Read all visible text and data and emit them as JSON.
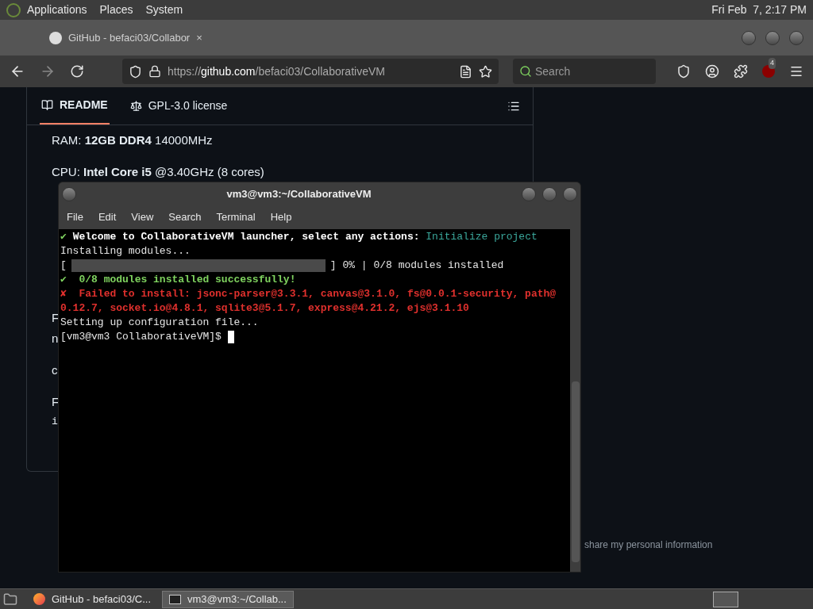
{
  "top_panel": {
    "menus": [
      "Applications",
      "Places",
      "System"
    ],
    "clock": "Fri Feb  7, 2:17 PM"
  },
  "browser": {
    "tab": {
      "title": "GitHub - befaci03/Collabor",
      "close": "×"
    },
    "url": {
      "prefix": "https://",
      "host": "github.com",
      "path": "/befaci03/CollaborativeVM"
    },
    "search": {
      "placeholder": "Search"
    },
    "extension_badge": "4",
    "readme": {
      "tabs": [
        {
          "label": "README",
          "selected": true
        },
        {
          "label": "GPL-3.0 license",
          "selected": false
        }
      ],
      "lines": [
        "RAM: **12GB DDR4** 14000MHz",
        "CPU: **Intel Core i5** @3.40GHz (8 cores)"
      ],
      "fragments": [
        {
          "text": "F",
          "kind": "line"
        },
        {
          "text": "n",
          "kind": "wrap"
        },
        {
          "text": "c",
          "kind": "line"
        },
        {
          "text": "F",
          "kind": "line"
        },
        {
          "text": "i",
          "kind": "code"
        }
      ]
    },
    "footer_text": "share my personal information"
  },
  "terminal": {
    "title": "vm3@vm3:~/CollaborativeVM",
    "menu": [
      "File",
      "Edit",
      "View",
      "Search",
      "Terminal",
      "Help"
    ],
    "lines": [
      {
        "kind": "text",
        "segments": [
          {
            "text": "✔",
            "kind": "ok"
          },
          {
            "text": " Welcome to CollaborativeVM launcher, select any actions: ",
            "kind": "bold"
          },
          {
            "text": "Initialize project",
            "kind": "accent"
          }
        ]
      },
      {
        "kind": "text",
        "segments": [
          {
            "text": "Installing modules...",
            "kind": "plain"
          }
        ]
      },
      {
        "kind": "progress",
        "open": "[",
        "level": 0,
        "close": "] 0% | 0/8 modules installed"
      },
      {
        "kind": "text",
        "segments": [
          {
            "text": "✔",
            "kind": "ok"
          },
          {
            "text": "  0/8 modules installed successfully!",
            "kind": "ok-bold"
          }
        ]
      },
      {
        "kind": "text",
        "segments": [
          {
            "text": "✘  Failed to install: jsonc-parser@3.3.1, canvas@3.1.0, fs@0.0.1-security, path@",
            "kind": "error"
          }
        ]
      },
      {
        "kind": "text",
        "segments": [
          {
            "text": "0.12.7, socket.io@4.8.1, sqlite3@5.1.7, express@4.21.2, ejs@3.1.10",
            "kind": "error"
          }
        ]
      },
      {
        "kind": "text",
        "segments": [
          {
            "text": "Setting up configuration file...",
            "kind": "plain"
          }
        ]
      },
      {
        "kind": "prompt",
        "segments": [
          {
            "text": "[vm3@vm3 CollaborativeVM]$ ",
            "kind": "plain"
          }
        ]
      }
    ]
  },
  "taskbar": {
    "items": [
      {
        "label": "GitHub - befaci03/C...",
        "kind": "browser",
        "selected": false
      },
      {
        "label": "vm3@vm3:~/Collab...",
        "kind": "terminal",
        "selected": true
      }
    ]
  }
}
